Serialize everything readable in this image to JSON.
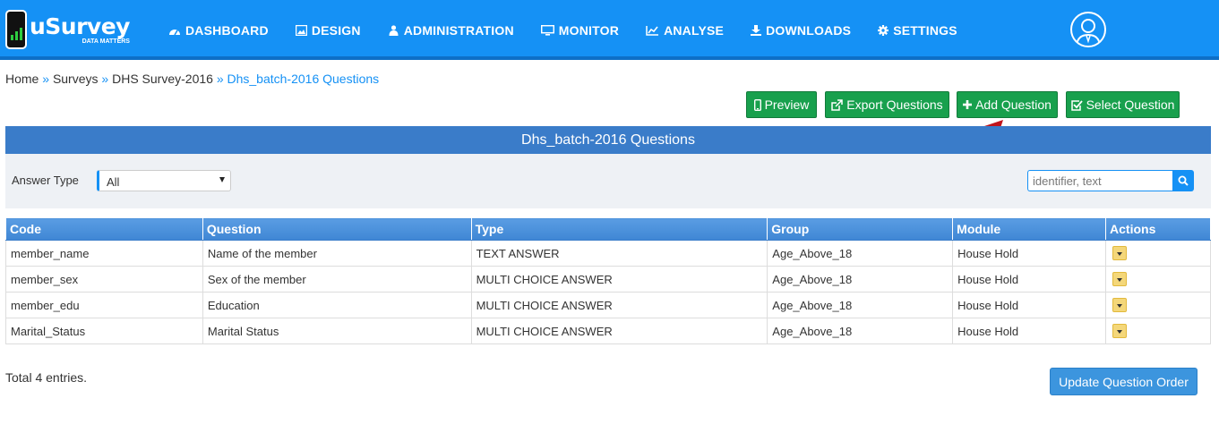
{
  "brand": {
    "name": "uSurvey",
    "tagline": "DATA MATTERS"
  },
  "nav": {
    "items": [
      {
        "label": "DASHBOARD",
        "icon": "dashboard-icon"
      },
      {
        "label": "DESIGN",
        "icon": "image-icon"
      },
      {
        "label": "ADMINISTRATION",
        "icon": "users-icon"
      },
      {
        "label": "MONITOR",
        "icon": "monitor-icon"
      },
      {
        "label": "ANALYSE",
        "icon": "line-chart-icon"
      },
      {
        "label": "DOWNLOADS",
        "icon": "download-icon"
      },
      {
        "label": "SETTINGS",
        "icon": "gear-icon"
      }
    ],
    "user_icon": "user-avatar-icon"
  },
  "breadcrumb": {
    "home": "Home",
    "surveys": "Surveys",
    "survey": "DHS Survey-2016",
    "current": "Dhs_batch-2016 Questions",
    "separator": "»"
  },
  "actions": {
    "preview": "Preview",
    "export": "Export Questions",
    "add": "Add Question",
    "select": "Select Question"
  },
  "panel": {
    "title": "Dhs_batch-2016 Questions"
  },
  "filter": {
    "answer_type_label": "Answer Type",
    "answer_type_value": "All",
    "search_placeholder": "identifier, text"
  },
  "table": {
    "headers": {
      "code": "Code",
      "question": "Question",
      "type": "Type",
      "group": "Group",
      "module": "Module",
      "actions": "Actions"
    },
    "rows": [
      {
        "code": "member_name",
        "question": "Name of the member",
        "type": "TEXT ANSWER",
        "group": "Age_Above_18",
        "module": "House Hold"
      },
      {
        "code": "member_sex",
        "question": "Sex of the member",
        "type": "MULTI CHOICE ANSWER",
        "group": "Age_Above_18",
        "module": "House Hold"
      },
      {
        "code": "member_edu",
        "question": "Education",
        "type": "MULTI CHOICE ANSWER",
        "group": "Age_Above_18",
        "module": "House Hold"
      },
      {
        "code": "Marital_Status",
        "question": "Marital Status",
        "type": "MULTI CHOICE ANSWER",
        "group": "Age_Above_18",
        "module": "House Hold"
      }
    ]
  },
  "footer": {
    "total": "Total 4 entries.",
    "update_order": "Update Question Order"
  },
  "colors": {
    "navbar": "#1591f5",
    "green": "#18a04d",
    "panel": "#3a7cc9",
    "arrow": "#c0141c"
  }
}
